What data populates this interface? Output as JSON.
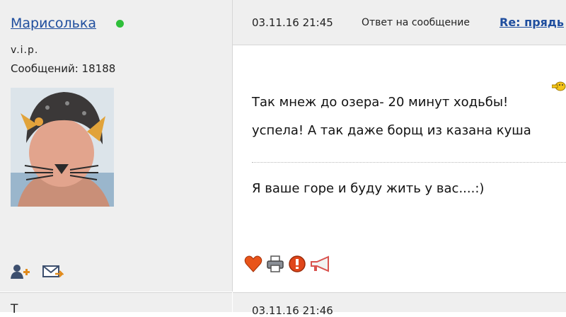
{
  "author": {
    "name": "Марисолька",
    "rank": "v.i.p.",
    "posts_label": "Сообщений: 18188"
  },
  "post": {
    "date": "03.11.16 21:45",
    "reply_label": "Ответ на сообщение",
    "reply_link": "Re: прядь",
    "lines": [
      "Так мнеж до озера- 20 минут ходьбы!",
      "успела! А так даже борщ из казана куша",
      "Я ваше горе и буду жить у вас....:)"
    ]
  },
  "icons": {
    "author_actions": [
      "add-friend-icon",
      "send-message-icon"
    ],
    "post_actions": [
      "heart-icon",
      "print-icon",
      "report-icon",
      "megaphone-icon"
    ]
  },
  "next_post": {
    "name": "Т",
    "date": "03.11.16 21:46"
  },
  "colors": {
    "link": "#1f4e9e",
    "online": "#2fbf3a",
    "panel": "#efefef"
  }
}
